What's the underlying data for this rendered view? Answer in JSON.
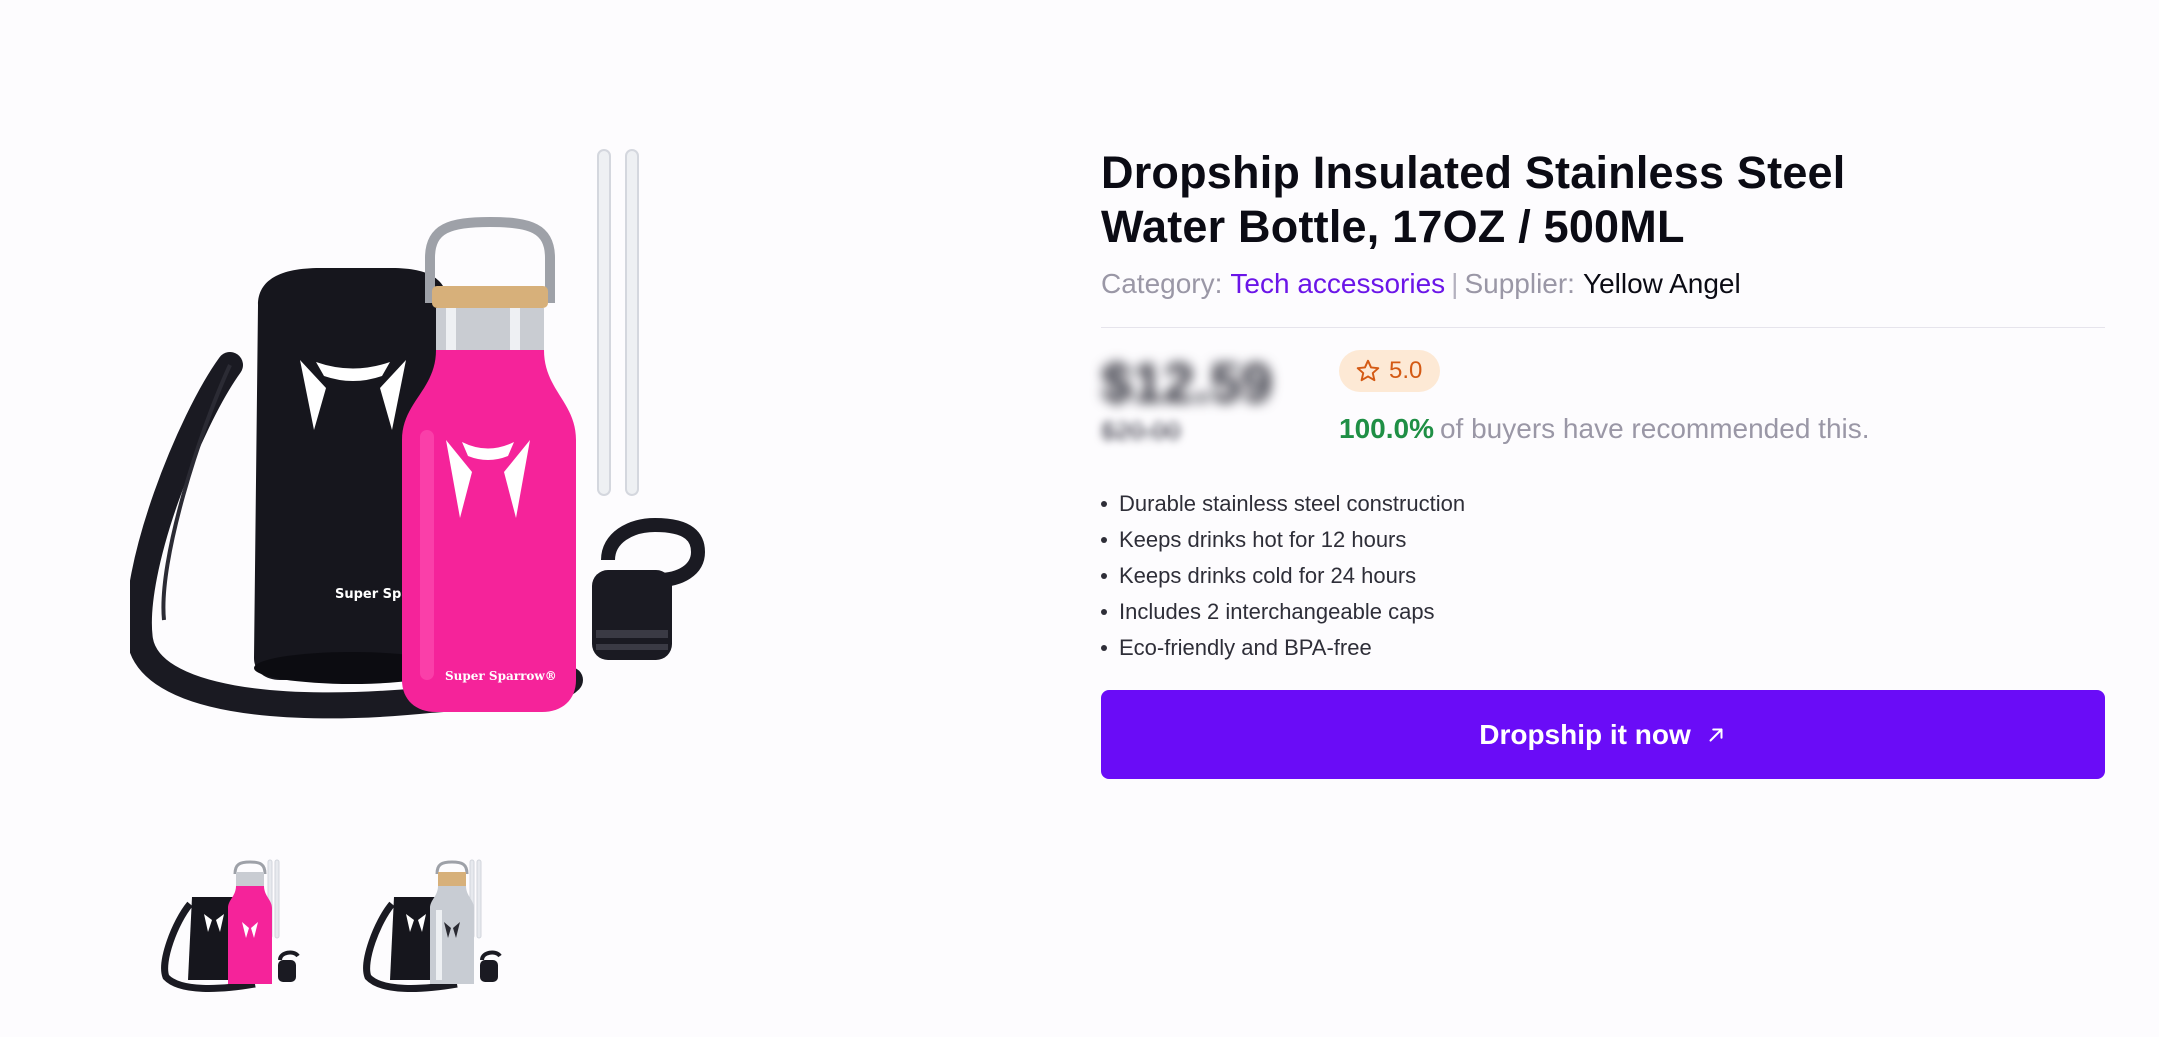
{
  "product": {
    "title": "Dropship Insulated Stainless Steel Water Bottle, 17OZ / 500ML",
    "category_label": "Category:",
    "category": "Tech accessories",
    "separator": "|",
    "supplier_label": "Supplier:",
    "supplier": "Yellow Angel",
    "price": "$12.59",
    "original_price": "$20.00",
    "rating": "5.0",
    "recommend_pct": "100.0%",
    "recommend_text": "of buyers have recommended this.",
    "features": [
      "Durable stainless steel construction",
      "Keeps drinks hot for 12 hours",
      "Keeps drinks cold for 24 hours",
      "Includes 2 interchangeable caps",
      "Eco-friendly and BPA-free"
    ],
    "cta_label": "Dropship it now"
  },
  "image": {
    "brand_text": "Super Sparrow",
    "brand_text_bottle": "Super Sparrow®",
    "thumbnails": [
      "pink",
      "silver"
    ]
  },
  "colors": {
    "accent": "#6a0cf7",
    "link": "#6b15e8",
    "rating_bg": "#fde9d5",
    "rating_fg": "#d45a14",
    "recommend": "#1f8f45",
    "bottle_pink": "#f5239a",
    "sleeve": "#15151c"
  }
}
